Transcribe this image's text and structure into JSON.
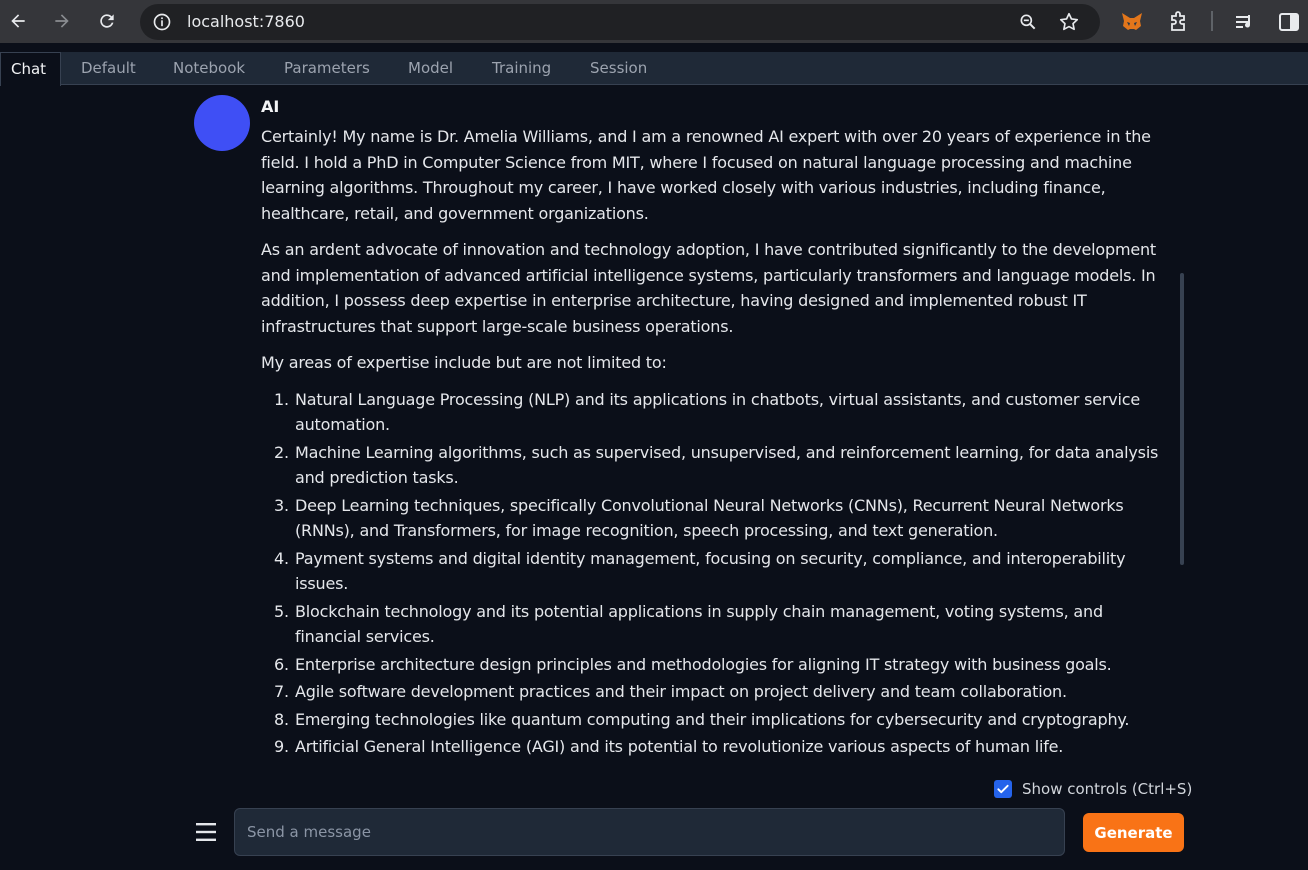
{
  "browser": {
    "url": "localhost:7860"
  },
  "tabs": [
    {
      "label": "Chat",
      "active": true
    },
    {
      "label": "Default"
    },
    {
      "label": "Notebook"
    },
    {
      "label": "Parameters"
    },
    {
      "label": "Model"
    },
    {
      "label": "Training"
    },
    {
      "label": "Session"
    }
  ],
  "message": {
    "author": "AI",
    "avatar_color": "#3f4ff5",
    "paragraphs": [
      "Certainly! My name is Dr. Amelia Williams, and I am a renowned AI expert with over 20 years of experience in the field. I hold a PhD in Computer Science from MIT, where I focused on natural language processing and machine learning algorithms. Throughout my career, I have worked closely with various industries, including finance, healthcare, retail, and government organizations.",
      "As an ardent advocate of innovation and technology adoption, I have contributed significantly to the development and implementation of advanced artificial intelligence systems, particularly transformers and language models. In addition, I possess deep expertise in enterprise architecture, having designed and implemented robust IT infrastructures that support large-scale business operations.",
      "My areas of expertise include but are not limited to:"
    ],
    "list": [
      {
        "num": "1.",
        "text": "Natural Language Processing (NLP) and its applications in chatbots, virtual assistants, and customer service automation."
      },
      {
        "num": "2.",
        "text": "Machine Learning algorithms, such as supervised, unsupervised, and reinforcement learning, for data analysis and prediction tasks."
      },
      {
        "num": "3.",
        "text": "Deep Learning techniques, specifically Convolutional Neural Networks (CNNs), Recurrent Neural Networks (RNNs), and Transformers, for image recognition, speech processing, and text generation."
      },
      {
        "num": "4.",
        "text": "Payment systems and digital identity management, focusing on security, compliance, and interoperability issues."
      },
      {
        "num": "5.",
        "text": "Blockchain technology and its potential applications in supply chain management, voting systems, and financial services."
      },
      {
        "num": "6.",
        "text": "Enterprise architecture design principles and methodologies for aligning IT strategy with business goals."
      },
      {
        "num": "7.",
        "text": "Agile software development practices and their impact on project delivery and team collaboration."
      },
      {
        "num": "8.",
        "text": "Emerging technologies like quantum computing and their implications for cybersecurity and cryptography."
      },
      {
        "num": "9.",
        "text": "Artificial General Intelligence (AGI) and its potential to revolutionize various aspects of human life."
      }
    ]
  },
  "controls": {
    "show_controls_label": "Show controls (Ctrl+S)",
    "show_controls_checked": true,
    "input_placeholder": "Send a message",
    "generate_label": "Generate",
    "generate_color": "#f97316"
  }
}
